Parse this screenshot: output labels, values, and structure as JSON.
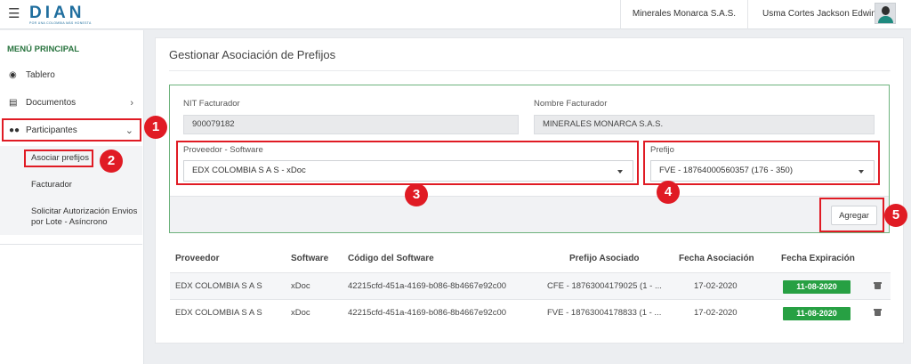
{
  "header": {
    "logo_text": "DIAN",
    "logo_subtitle": "POR UNA COLOMBIA MÁS HONESTA",
    "company": "Minerales Monarca S.A.S.",
    "user_name": "Usma Cortes Jackson Edwin"
  },
  "sidebar": {
    "title": "MENÚ PRINCIPAL",
    "items": [
      {
        "label": "Tablero",
        "icon": "dashboard-icon"
      },
      {
        "label": "Documentos",
        "icon": "inbox-icon"
      },
      {
        "label": "Participantes",
        "icon": "users-icon"
      }
    ],
    "subitems": [
      {
        "label": "Asociar prefijos"
      },
      {
        "label": "Facturador"
      },
      {
        "label": "Solicitar Autorización Envios por Lote - Asíncrono"
      }
    ]
  },
  "main": {
    "title": "Gestionar Asociación de Prefijos",
    "form": {
      "nit_label": "NIT Facturador",
      "nit_value": "900079182",
      "nombre_label": "Nombre Facturador",
      "nombre_value": "MINERALES MONARCA S.A.S.",
      "proveedor_label": "Proveedor - Software",
      "proveedor_value": "EDX COLOMBIA S A S - xDoc",
      "prefijo_label": "Prefijo",
      "prefijo_value": "FVE - 18764000560357 (176 - 350)",
      "agregar_label": "Agregar"
    },
    "table": {
      "headers": [
        "Proveedor",
        "Software",
        "Código del Software",
        "Prefijo Asociado",
        "Fecha Asociación",
        "Fecha Expiración"
      ],
      "rows": [
        {
          "proveedor": "EDX COLOMBIA S A S",
          "software": "xDoc",
          "codigo": "42215cfd-451a-4169-b086-8b4667e92c00",
          "prefijo": "CFE - 18763004179025 (1 - ...",
          "fecha_asociacion": "17-02-2020",
          "fecha_expiracion": "11-08-2020"
        },
        {
          "proveedor": "EDX COLOMBIA S A S",
          "software": "xDoc",
          "codigo": "42215cfd-451a-4169-b086-8b4667e92c00",
          "prefijo": "FVE - 18763004178833 (1 - ...",
          "fecha_asociacion": "17-02-2020",
          "fecha_expiracion": "11-08-2020"
        }
      ]
    }
  },
  "annotations": {
    "markers": [
      "1",
      "2",
      "3",
      "4",
      "5"
    ],
    "color": "#e01b24"
  },
  "colors": {
    "brand_blue": "#1f6e9e",
    "menu_green": "#29743f",
    "badge_green": "#27a043",
    "form_border": "#6db27c"
  }
}
